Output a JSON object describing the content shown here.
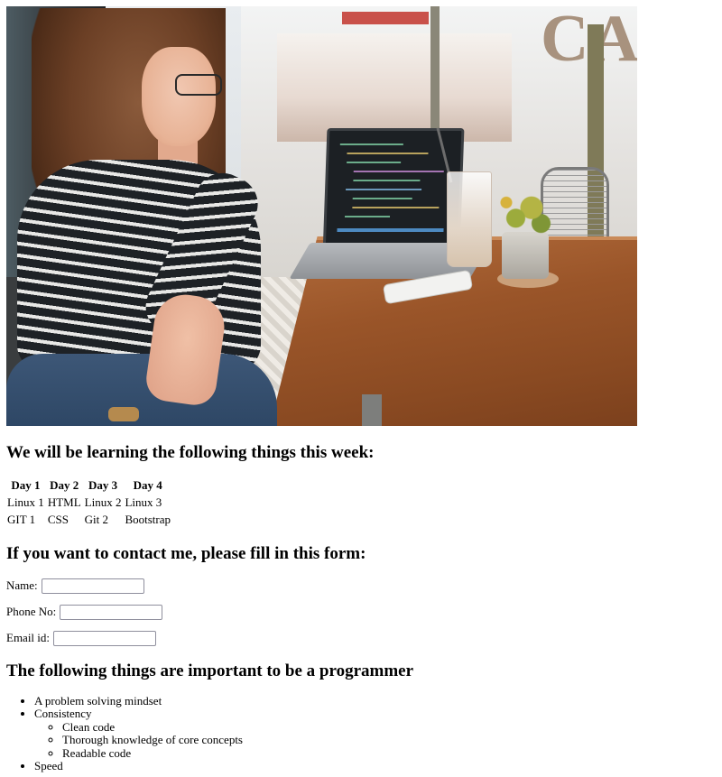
{
  "hero": {
    "alt": "Woman sitting at a wooden cafe table with a laptop showing code"
  },
  "learning": {
    "heading": "We will be learning the following things this week:",
    "schedule": {
      "headers": [
        "Day 1",
        "Day 2",
        "Day 3",
        "Day 4"
      ],
      "rows": [
        [
          "Linux 1",
          "HTML",
          "Linux 2",
          "Linux 3"
        ],
        [
          "GIT 1",
          "CSS",
          "Git 2",
          "Bootstrap"
        ]
      ]
    }
  },
  "contact": {
    "heading": "If you want to contact me, please fill in this form:",
    "fields": {
      "name_label": "Name:",
      "name_value": "",
      "phone_label": "Phone No:",
      "phone_value": "",
      "email_label": "Email id:",
      "email_value": ""
    }
  },
  "programmer": {
    "heading": "The following things are important to be a programmer",
    "items": {
      "0": "A problem solving mindset",
      "1": "Consistency",
      "1_sub": [
        "Clean code",
        "Thorough knowledge of core concepts",
        "Readable code"
      ],
      "2": "Speed"
    }
  }
}
